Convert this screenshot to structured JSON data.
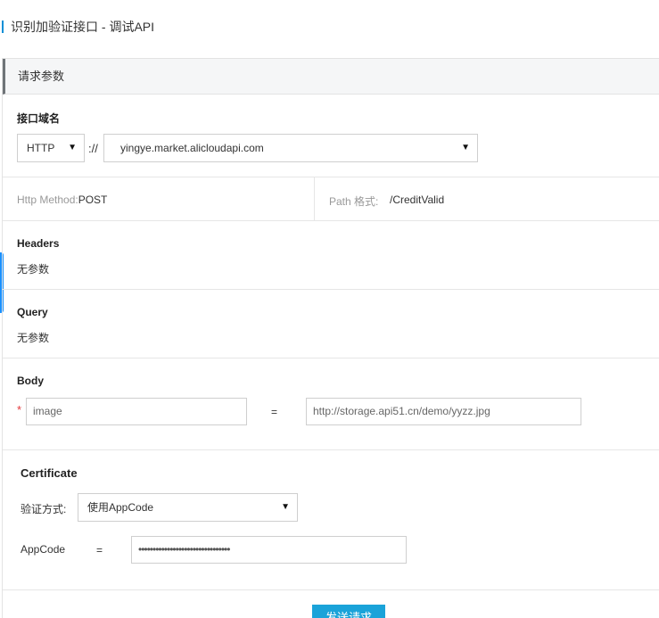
{
  "header": {
    "title": "识别加验证接口 - 调试API"
  },
  "panel": {
    "title": "请求参数"
  },
  "domain": {
    "label": "接口域名",
    "protocol": "HTTP",
    "separator": "://",
    "host": "yingye.market.alicloudapi.com"
  },
  "method": {
    "label": "Http Method:",
    "value": "POST",
    "path_label": "Path 格式:",
    "path_value": "/CreditValid"
  },
  "headers": {
    "label": "Headers",
    "empty_text": "无参数"
  },
  "query": {
    "label": "Query",
    "empty_text": "无参数"
  },
  "body": {
    "label": "Body",
    "required_mark": "*",
    "param_name": "image",
    "equals": "=",
    "param_value": "http://storage.api51.cn/demo/yyzz.jpg"
  },
  "certificate": {
    "label": "Certificate",
    "auth_label": "验证方式:",
    "auth_value": "使用AppCode",
    "appcode_label": "AppCode",
    "equals": "=",
    "appcode_value": "••••••••••••••••••••••••••••••••"
  },
  "actions": {
    "send_label": "发送请求"
  },
  "icons": {
    "caret": "▼"
  },
  "colors": {
    "accent": "#1aa3d9",
    "side_tab": "#1890ff",
    "required": "#e4393c"
  }
}
